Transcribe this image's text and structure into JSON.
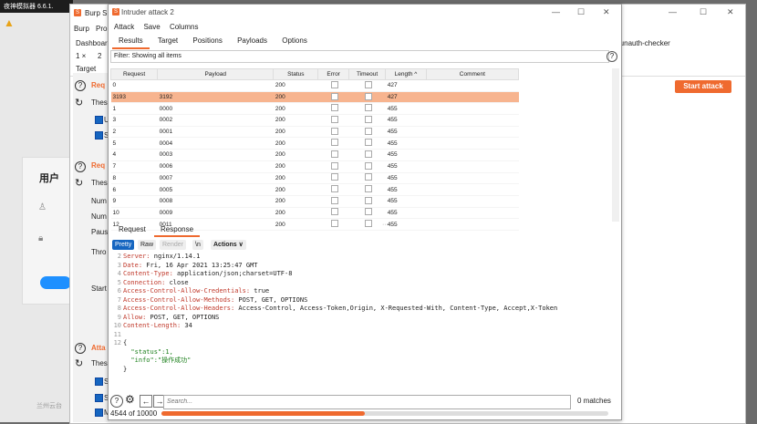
{
  "emulator": {
    "title": "夜神模拟器 6.6.1.",
    "footer": "兰州云台"
  },
  "burp": {
    "title": "Burp Sui",
    "menu": [
      "Burp",
      "Pro"
    ],
    "row2": [
      "Dashboar"
    ],
    "tab_num": "1 ×",
    "tab_num2": "2",
    "target_tab": "Target",
    "right_tab": "-unauth-checker",
    "start_attack": "Start attack",
    "login_title": "用户",
    "left": {
      "req1": "Req",
      "these1": "Thes",
      "u1": "U",
      "s1": "S",
      "req2": "Req",
      "these2": "Thes",
      "num1": "Num",
      "num2": "Num",
      "paus": "Paus",
      "thro": "Thro",
      "start": "Start",
      "atta": "Atta",
      "these3": "Thes",
      "s2": "S",
      "s3": "S",
      "m": "M"
    }
  },
  "intruder": {
    "title": "Intruder attack 2",
    "menu": [
      "Attack",
      "Save",
      "Columns"
    ],
    "tabs": [
      "Results",
      "Target",
      "Positions",
      "Payloads",
      "Options"
    ],
    "filter": "Filter: Showing all items",
    "columns": [
      "Request",
      "Payload",
      "Status",
      "Error",
      "Timeout",
      "Length ^",
      "Comment"
    ],
    "rows": [
      {
        "req": "0",
        "payload": "",
        "status": "200",
        "length": "427"
      },
      {
        "req": "3193",
        "payload": "3192",
        "status": "200",
        "length": "427"
      },
      {
        "req": "1",
        "payload": "0000",
        "status": "200",
        "length": "455"
      },
      {
        "req": "3",
        "payload": "0002",
        "status": "200",
        "length": "455"
      },
      {
        "req": "2",
        "payload": "0001",
        "status": "200",
        "length": "455"
      },
      {
        "req": "5",
        "payload": "0004",
        "status": "200",
        "length": "455"
      },
      {
        "req": "4",
        "payload": "0003",
        "status": "200",
        "length": "455"
      },
      {
        "req": "7",
        "payload": "0006",
        "status": "200",
        "length": "455"
      },
      {
        "req": "8",
        "payload": "0007",
        "status": "200",
        "length": "455"
      },
      {
        "req": "6",
        "payload": "0005",
        "status": "200",
        "length": "455"
      },
      {
        "req": "9",
        "payload": "0008",
        "status": "200",
        "length": "455"
      },
      {
        "req": "10",
        "payload": "0009",
        "status": "200",
        "length": "455"
      },
      {
        "req": "12",
        "payload": "0011",
        "status": "200",
        "length": "455"
      }
    ],
    "rr_tabs": [
      "Request",
      "Response"
    ],
    "view_buttons": [
      "Pretty",
      "Raw",
      "Render",
      "\\n",
      "Actions ∨"
    ],
    "response_lines": [
      {
        "n": "2",
        "k": "Server:",
        "v": " nginx/1.14.1"
      },
      {
        "n": "3",
        "k": "Date:",
        "v": " Fri, 16 Apr 2021 13:25:47 GMT"
      },
      {
        "n": "4",
        "k": "Content-Type:",
        "v": " application/json;charset=UTF-8"
      },
      {
        "n": "5",
        "k": "Connection:",
        "v": " close"
      },
      {
        "n": "6",
        "k": "Access-Control-Allow-Credentials:",
        "v": " true"
      },
      {
        "n": "7",
        "k": "Access-Control-Allow-Methods:",
        "v": " POST, GET, OPTIONS"
      },
      {
        "n": "8",
        "k": "Access-Control-Allow-Headers:",
        "v": " Access-Control, Access-Token,Origin, X-Requested-With, Content-Type, Accept,X-Token"
      },
      {
        "n": "9",
        "k": "Allow:",
        "v": " POST, GET, OPTIONS"
      },
      {
        "n": "10",
        "k": "Content-Length:",
        "v": " 34"
      },
      {
        "n": "11",
        "k": "",
        "v": ""
      },
      {
        "n": "12",
        "k": "",
        "v": "{"
      },
      {
        "n": "",
        "k": "",
        "v": "  \"status\":1,"
      },
      {
        "n": "",
        "k": "",
        "v": "  \"info\":\"操作成功\""
      },
      {
        "n": "",
        "k": "",
        "v": "}"
      }
    ],
    "search_placeholder": "Search...",
    "matches": "0 matches",
    "progress_text": "4544 of 10000",
    "progress_fraction": 0.4544
  }
}
